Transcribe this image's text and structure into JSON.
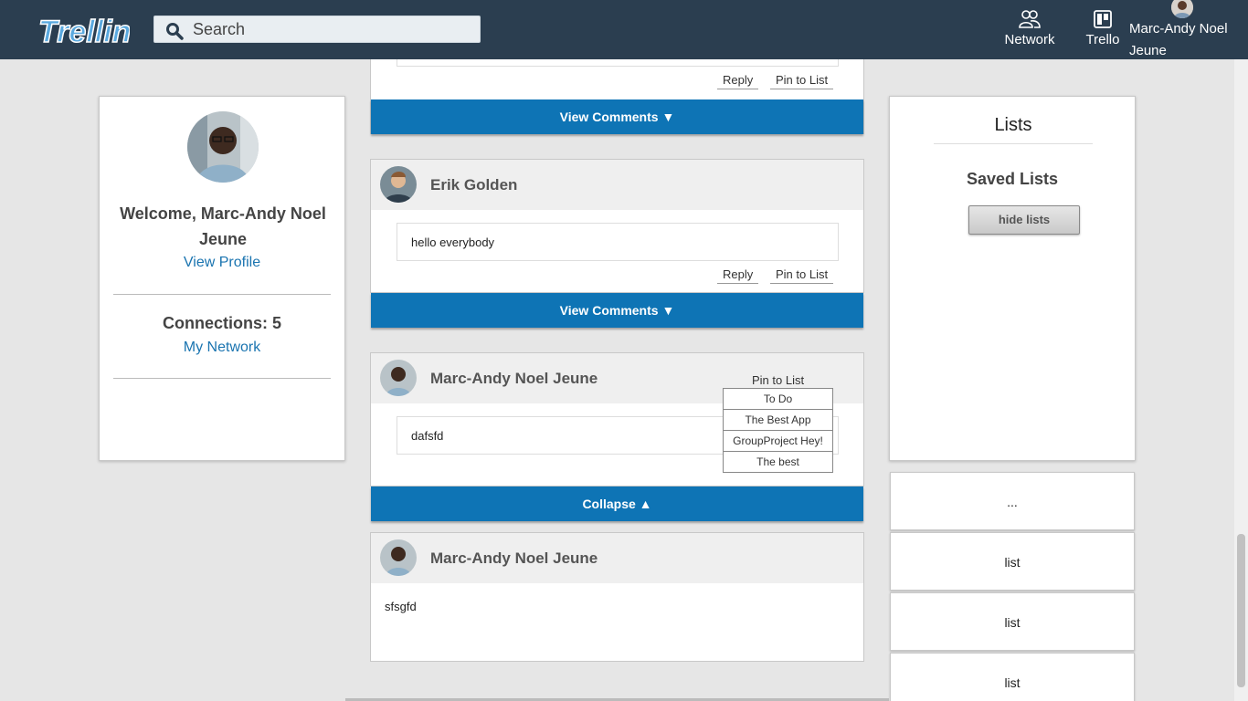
{
  "navbar": {
    "logo_text": "Trellin",
    "search_placeholder": "Search",
    "network_label": "Network",
    "trello_label": "Trello",
    "user_name": "Marc-Andy Noel Jeune"
  },
  "profile": {
    "welcome": "Welcome, Marc-Andy Noel Jeune",
    "view_profile": "View Profile",
    "connections": "Connections: 5",
    "my_network": "My Network"
  },
  "feed": {
    "partial_post": {
      "reply": "Reply",
      "pin": "Pin to List",
      "view_comments": "View Comments ▼"
    },
    "posts": [
      {
        "author": "Erik Golden",
        "body": "hello everybody",
        "reply": "Reply",
        "pin": "Pin to List",
        "view_comments": "View Comments ▼"
      },
      {
        "author": "Marc-Andy Noel Jeune",
        "body": "dafsfd",
        "pin": "Pin to List",
        "collapse": "Collapse ▲",
        "pin_options": [
          "To Do",
          "The Best App",
          "GroupProject Hey!",
          "The best"
        ]
      },
      {
        "author": "Marc-Andy Noel Jeune",
        "body": "sfsgfd"
      }
    ]
  },
  "lists_panel": {
    "title": "Lists",
    "saved_title": "Saved Lists",
    "hide_button": "hide lists",
    "items": [
      "...",
      "list",
      "list",
      "list"
    ]
  },
  "colors": {
    "navbar": "#2b3e50",
    "accent_blue": "#0e74b5",
    "link": "#1a74b0"
  }
}
